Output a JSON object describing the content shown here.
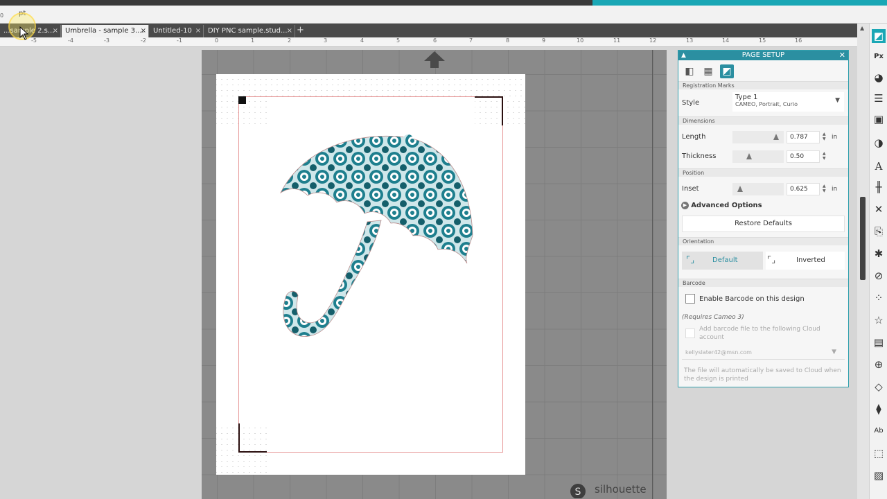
{
  "units": {
    "label": "pt",
    "zero": "0"
  },
  "tabs": [
    {
      "label": "...sample 2.s...",
      "active": false
    },
    {
      "label": "Umbrella - sample 3....",
      "active": true
    },
    {
      "label": "Untitled-10",
      "active": false
    },
    {
      "label": "DIY PNC sample.stud...",
      "active": false
    }
  ],
  "ruler": {
    "ticks": [
      "-5",
      "-4",
      "-3",
      "-2",
      "-1",
      "0",
      "1",
      "2",
      "3",
      "4",
      "5",
      "6",
      "7",
      "8",
      "9",
      "10",
      "11",
      "12",
      "13",
      "14",
      "15",
      "16"
    ]
  },
  "canvas": {
    "brand": "silhouette"
  },
  "panel": {
    "title": "PAGE SETUP",
    "sections": {
      "registration": "Registration Marks",
      "dimensions": "Dimensions",
      "position": "Position",
      "orientation": "Orientation",
      "barcode": "Barcode"
    },
    "style": {
      "label": "Style",
      "value_title": "Type 1",
      "value_sub": "CAMEO, Portrait, Curio"
    },
    "length": {
      "label": "Length",
      "value": "0.787",
      "unit": "in",
      "slider": 0.9
    },
    "thickness": {
      "label": "Thickness",
      "value": "0.50",
      "unit": "in",
      "slider": 0.3
    },
    "inset": {
      "label": "Inset",
      "value": "0.625",
      "unit": "in",
      "slider": 0.1
    },
    "advanced_label": "Advanced Options",
    "restore_label": "Restore Defaults",
    "orient_default": "Default",
    "orient_inverted": "Inverted",
    "barcode_enable": "Enable Barcode on this design",
    "requires": "(Requires Cameo 3)",
    "add_barcode": "Add barcode file to the following Cloud account",
    "account": "kellyslater42@msn.com",
    "note": "The file will automatically be saved to Cloud when the design is printed"
  },
  "colors": {
    "accent": "#2b8fa1",
    "pattern": "#1e7f8e"
  }
}
